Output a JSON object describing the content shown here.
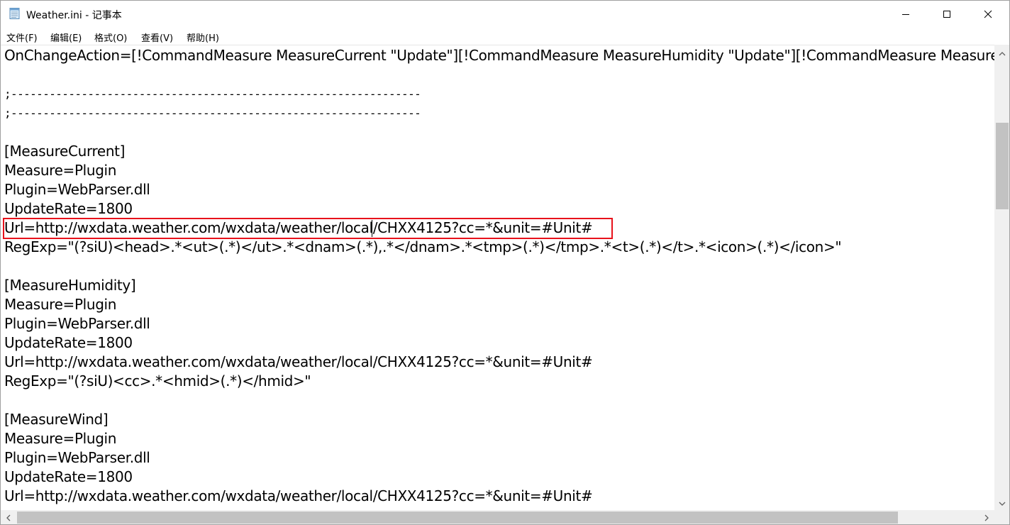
{
  "window": {
    "title": "Weather.ini - 记事本",
    "app_icon": "notepad-icon",
    "controls": {
      "minimize": "minimize-icon",
      "maximize": "maximize-icon",
      "close": "close-icon"
    }
  },
  "menu": {
    "file": "文件(F)",
    "edit": "编辑(E)",
    "format": "格式(O)",
    "view": "查看(V)",
    "help": "帮助(H)"
  },
  "editor": {
    "lines": {
      "l0": "OnChangeAction=[!CommandMeasure MeasureCurrent \"Update\"][!CommandMeasure MeasureHumidity \"Update\"][!CommandMeasure MeasureW",
      "l1": "",
      "l2": ";----------------------------------------------------------------",
      "l3": ";----------------------------------------------------------------",
      "l4": "",
      "l5": "[MeasureCurrent]",
      "l6": "Measure=Plugin",
      "l7": "Plugin=WebParser.dll",
      "l8": "UpdateRate=1800",
      "l9": "Url=http://wxdata.weather.com/wxdata/weather/local/CHXX4125?cc=*&unit=#Unit#",
      "l10": "RegExp=\"(?siU)<head>.*<ut>(.*)</ut>.*<dnam>(.*),.*</dnam>.*<tmp>(.*)</tmp>.*<t>(.*)</t>.*<icon>(.*)</icon>\"",
      "l11": "",
      "l12": "[MeasureHumidity]",
      "l13": "Measure=Plugin",
      "l14": "Plugin=WebParser.dll",
      "l15": "UpdateRate=1800",
      "l16": "Url=http://wxdata.weather.com/wxdata/weather/local/CHXX4125?cc=*&unit=#Unit#",
      "l17": "RegExp=\"(?siU)<cc>.*<hmid>(.*)</hmid>\"",
      "l18": "",
      "l19": "[MeasureWind]",
      "l20": "Measure=Plugin",
      "l21": "Plugin=WebParser.dll",
      "l22": "UpdateRate=1800",
      "l23": "Url=http://wxdata.weather.com/wxdata/weather/local/CHXX4125?cc=*&unit=#Unit#"
    },
    "highlighted_line": "l9",
    "highlight_color": "#e8121b"
  },
  "scrollbars": {
    "vertical": {
      "up": "chevron-up-icon",
      "down": "chevron-down-icon"
    },
    "horizontal": {
      "left": "chevron-left-icon",
      "right": "chevron-right-icon"
    }
  }
}
